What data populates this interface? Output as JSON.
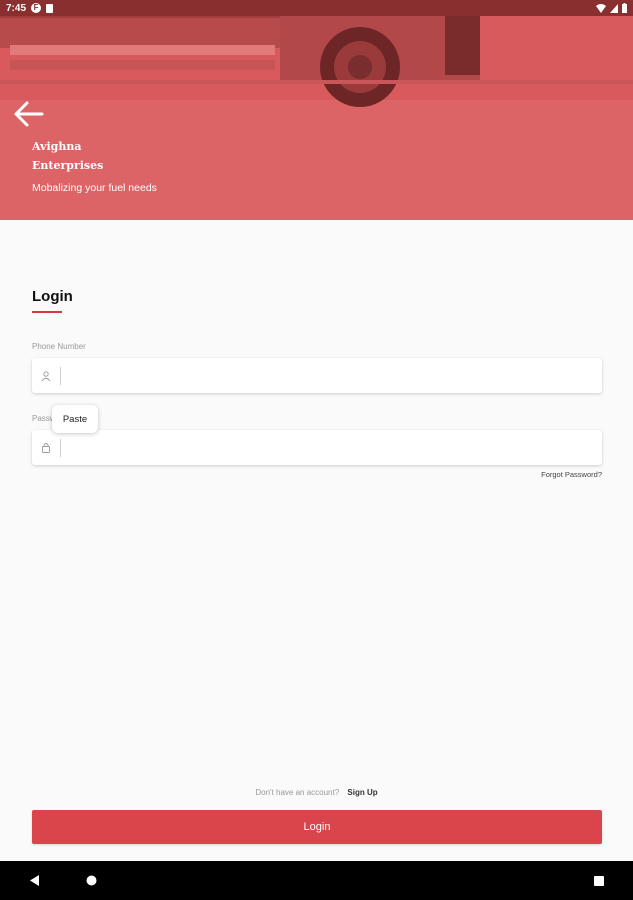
{
  "status_bar": {
    "time": "7:45"
  },
  "hero": {
    "brand_line1": "Avighna",
    "brand_line2": "Enterprises",
    "tagline": "Mobalizing your fuel needs"
  },
  "login": {
    "title": "Login",
    "phone_label": "Phone Number",
    "password_label": "Password",
    "paste_label": "Paste",
    "forgot_password": "Forgot Password?",
    "no_account_text": "Don't have an account?",
    "signup_link": "Sign Up",
    "login_button": "Login"
  },
  "colors": {
    "accent": "#d9454a",
    "hero": "#d9595b"
  },
  "icons": [
    "back-arrow-icon",
    "user-icon",
    "lock-icon",
    "nav-back-icon",
    "nav-home-icon",
    "nav-recents-icon"
  ]
}
